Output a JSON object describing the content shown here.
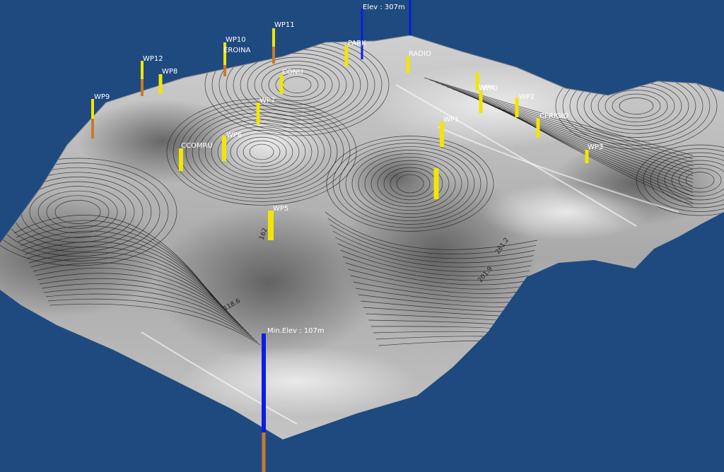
{
  "viewer": {
    "background_color": "#1f4a80",
    "terrain_color": "#b8b8b8",
    "contour_color": "#1a1a1a"
  },
  "elevation": {
    "max_label": "Elev : 307m",
    "min_label": "Min.Elev : 107m",
    "max_value_m": 307,
    "min_value_m": 107,
    "marker_color": "#0a1ee0",
    "stem_color": "#c87a2a"
  },
  "waypoint_style": {
    "marker_color": "#f2e600",
    "stem_color": "#c87a2a"
  },
  "waypoints": [
    {
      "id": "wp9",
      "label": "WP9"
    },
    {
      "id": "wp12",
      "label": "WP12"
    },
    {
      "id": "wp8",
      "label": "WP8"
    },
    {
      "id": "wp10",
      "label": "WP10"
    },
    {
      "id": "eroina",
      "label": "EROINA"
    },
    {
      "id": "wp11",
      "label": "WP11"
    },
    {
      "id": "conu",
      "label": "CONU"
    },
    {
      "id": "park",
      "label": "PARK"
    },
    {
      "id": "radio",
      "label": "RADIO"
    },
    {
      "id": "wp7",
      "label": "WP7"
    },
    {
      "id": "wp6",
      "label": "WP6"
    },
    {
      "id": "ccomru",
      "label": "CCOMRU"
    },
    {
      "id": "wp1",
      "label": "WP1"
    },
    {
      "id": "wp2",
      "label": "WP2"
    },
    {
      "id": "cprigio",
      "label": "CPRIGIO"
    },
    {
      "id": "wp3",
      "label": "WP3"
    },
    {
      "id": "wp4",
      "label": "WP4"
    },
    {
      "id": "wp5",
      "label": "WP5"
    },
    {
      "id": "wp0",
      "label": "WP0"
    }
  ],
  "contour_labels": [
    "201.9",
    "261.2",
    "118.6",
    "162"
  ]
}
